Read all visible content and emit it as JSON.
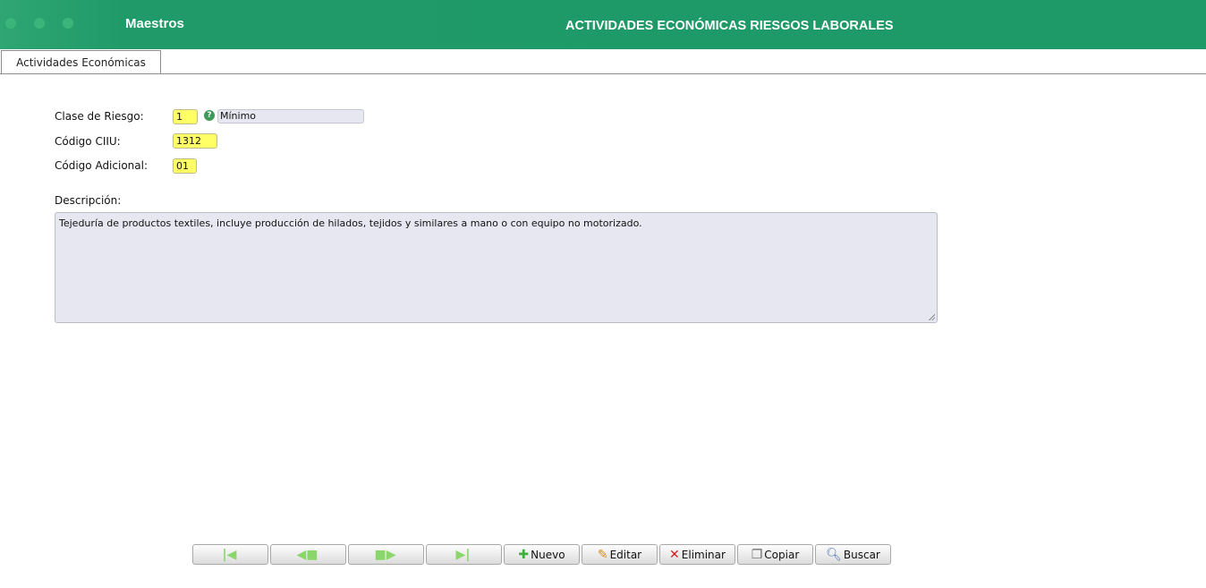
{
  "header": {
    "module": "Maestros",
    "title": "ACTIVIDADES ECONÓMICAS RIESGOS LABORALES"
  },
  "tabs": [
    {
      "label": "Actividades Económicas"
    }
  ],
  "form": {
    "clase_riesgo_label": "Clase de Riesgo:",
    "clase_riesgo_value": "1",
    "clase_riesgo_desc": "Mínimo",
    "codigo_ciiu_label": "Código CIIU:",
    "codigo_ciiu_value": "1312",
    "codigo_adicional_label": "Código Adicional:",
    "codigo_adicional_value": "01",
    "descripcion_label": "Descripción:",
    "descripcion_value": "Tejeduría de productos textiles, incluye producción de hilados, tejidos y similares a mano o con equipo no motorizado."
  },
  "toolbar": {
    "first_icon": "first-record-icon",
    "prev_icon": "arrow-left-icon",
    "next_icon": "arrow-right-icon",
    "last_icon": "last-record-icon",
    "nuevo": "Nuevo",
    "editar": "Editar",
    "eliminar": "Eliminar",
    "copiar": "Copiar",
    "buscar": "Buscar"
  },
  "colors": {
    "header_green": "#1e9a68",
    "input_yellow": "#ffff66",
    "readonly_bg": "#e6e7f1"
  }
}
